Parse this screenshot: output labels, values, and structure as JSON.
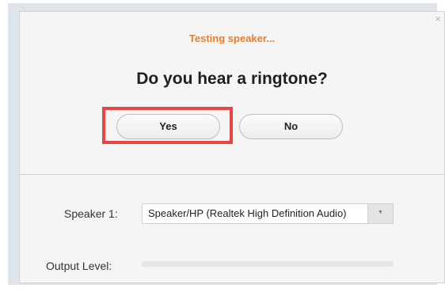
{
  "dialog": {
    "status_text": "Testing speaker...",
    "question": "Do you hear a ringtone?",
    "close_glyph": "×",
    "yes_label": "Yes",
    "no_label": "No"
  },
  "speaker": {
    "label": "Speaker 1:",
    "selected": "Speaker/HP (Realtek High Definition Audio)",
    "arrow_glyph": "▼"
  },
  "output": {
    "label": "Output Level:",
    "level": 0
  },
  "colors": {
    "status": "#e87d2e",
    "highlight": "#e84545"
  }
}
